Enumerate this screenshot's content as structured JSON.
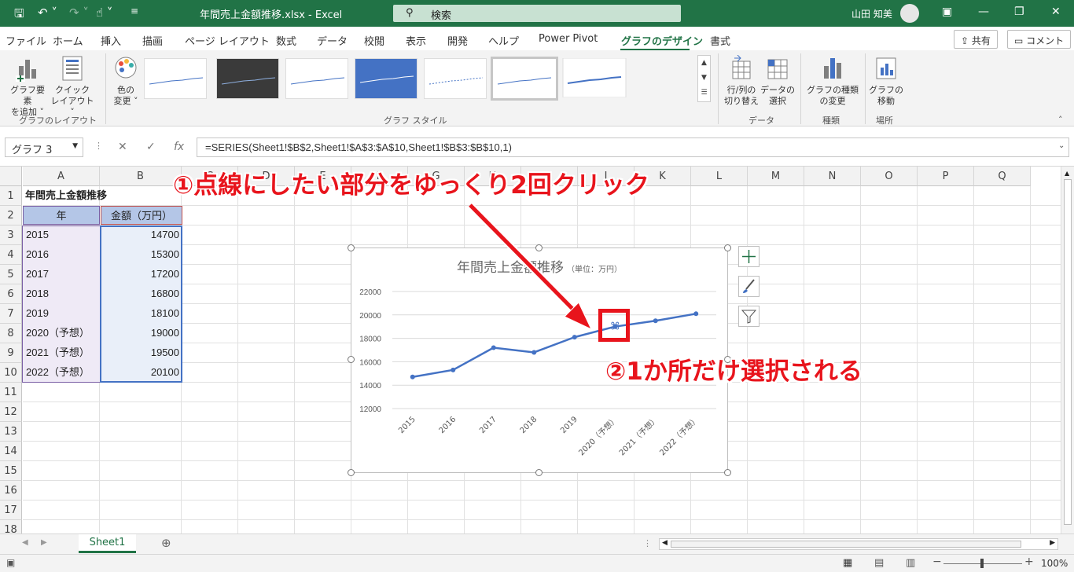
{
  "titlebar": {
    "doc_title": "年間売上金額推移.xlsx  -  Excel",
    "search_placeholder": "検索",
    "user_name": "山田 知美",
    "bg_color": "#217346"
  },
  "tabs": [
    "ファイル",
    "ホーム",
    "挿入",
    "描画",
    "ページ レイアウト",
    "数式",
    "データ",
    "校閲",
    "表示",
    "開発",
    "ヘルプ",
    "Power Pivot",
    "グラフのデザイン",
    "書式"
  ],
  "active_tab": "グラフのデザイン",
  "top_buttons": {
    "share": "共有",
    "comment": "コメント"
  },
  "ribbon": {
    "add_element": [
      "グラフ要素",
      "を追加 ˅"
    ],
    "quick_layout": [
      "クイック",
      "レイアウト ˅"
    ],
    "change_colors": [
      "色の",
      "変更 ˅"
    ],
    "switch_row_col": [
      "行/列の",
      "切り替え"
    ],
    "select_data": [
      "データの",
      "選択"
    ],
    "change_type": [
      "グラフの種類",
      "の変更"
    ],
    "move_chart": [
      "グラフの",
      "移動"
    ],
    "groups": {
      "layout": "グラフのレイアウト",
      "styles": "グラフ スタイル",
      "data": "データ",
      "type": "種類",
      "location": "場所"
    }
  },
  "formula_bar": {
    "name_box": "グラフ 3",
    "formula": "=SERIES(Sheet1!$B$2,Sheet1!$A$3:$A$10,Sheet1!$B$3:$B$10,1)"
  },
  "columns": [
    "A",
    "B",
    "C",
    "D",
    "E",
    "F",
    "G",
    "H",
    "I",
    "J",
    "K",
    "L",
    "M",
    "N",
    "O",
    "P",
    "Q"
  ],
  "rows": [
    "1",
    "2",
    "3",
    "4",
    "5",
    "6",
    "7",
    "8",
    "9",
    "10",
    "11",
    "12",
    "13",
    "14",
    "15",
    "16",
    "17",
    "18"
  ],
  "sheet": {
    "title": "年間売上金額推移",
    "header_year": "年",
    "header_amount": "金額（万円）",
    "data": [
      {
        "year": "2015",
        "amount": "14700"
      },
      {
        "year": "2016",
        "amount": "15300"
      },
      {
        "year": "2017",
        "amount": "17200"
      },
      {
        "year": "2018",
        "amount": "16800"
      },
      {
        "year": "2019",
        "amount": "18100"
      },
      {
        "year": "2020（予想）",
        "amount": "19000"
      },
      {
        "year": "2021（予想）",
        "amount": "19500"
      },
      {
        "year": "2022（予想）",
        "amount": "20100"
      }
    ]
  },
  "chart_data": {
    "type": "line",
    "title": "年間売上金額推移",
    "subtitle": "（単位：万円）",
    "categories": [
      "2015",
      "2016",
      "2017",
      "2018",
      "2019",
      "2020（予想）",
      "2021（予想）",
      "2022（予想）"
    ],
    "series": [
      {
        "values": [
          14700,
          15300,
          17200,
          16800,
          18100,
          19000,
          19500,
          20100
        ],
        "color": "#4472c4"
      }
    ],
    "yticks": [
      "12000",
      "14000",
      "16000",
      "18000",
      "20000",
      "22000"
    ],
    "ylim": [
      12000,
      22000
    ],
    "grid": true,
    "selected_point_index": 5
  },
  "annotations": {
    "step1": "①点線にしたい部分をゆっくり2回クリック",
    "step2": "②1か所だけ選択される",
    "color": "#e8141c"
  },
  "sheet_tab": "Sheet1",
  "zoom": "100%"
}
